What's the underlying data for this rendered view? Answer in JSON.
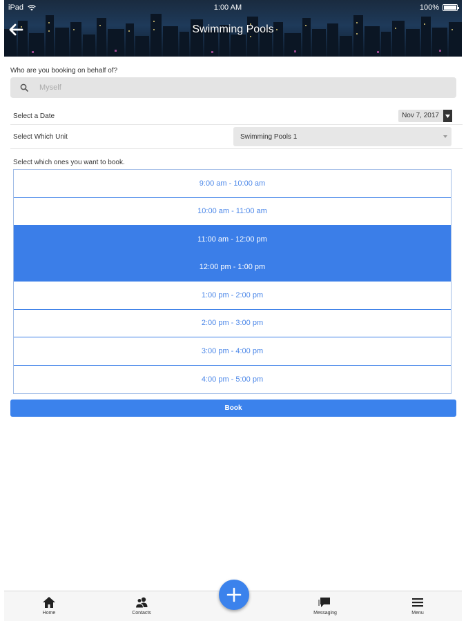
{
  "status_bar": {
    "device": "iPad",
    "time": "1:00 AM",
    "battery": "100%"
  },
  "header": {
    "title": "Swimming Pools",
    "back_icon": "back-arrow-icon"
  },
  "booking_for": {
    "label": "Who are you booking on behalf of?",
    "placeholder": "Myself",
    "value": ""
  },
  "date": {
    "label": "Select a Date",
    "value": "Nov 7, 2017"
  },
  "unit": {
    "label": "Select Which Unit",
    "value": "Swimming Pools 1"
  },
  "slots_label": "Select which ones you want to book.",
  "slots": [
    {
      "label": "9:00 am - 10:00 am",
      "selected": false
    },
    {
      "label": "10:00 am - 11:00 am",
      "selected": false
    },
    {
      "label": "11:00 am - 12:00 pm",
      "selected": true
    },
    {
      "label": "12:00 pm - 1:00 pm",
      "selected": true
    },
    {
      "label": "1:00 pm - 2:00 pm",
      "selected": false
    },
    {
      "label": "2:00 pm - 3:00 pm",
      "selected": false
    },
    {
      "label": "3:00 pm - 4:00 pm",
      "selected": false
    },
    {
      "label": "4:00 pm - 5:00 pm",
      "selected": false
    }
  ],
  "book_button": "Book",
  "tabbar": {
    "home": "Home",
    "contacts": "Contacts",
    "messaging": "Messaging",
    "menu": "Menu"
  },
  "colors": {
    "accent": "#3b7ee8",
    "slot_text": "#4a86e8",
    "header_bg": "#1e3a5a"
  }
}
